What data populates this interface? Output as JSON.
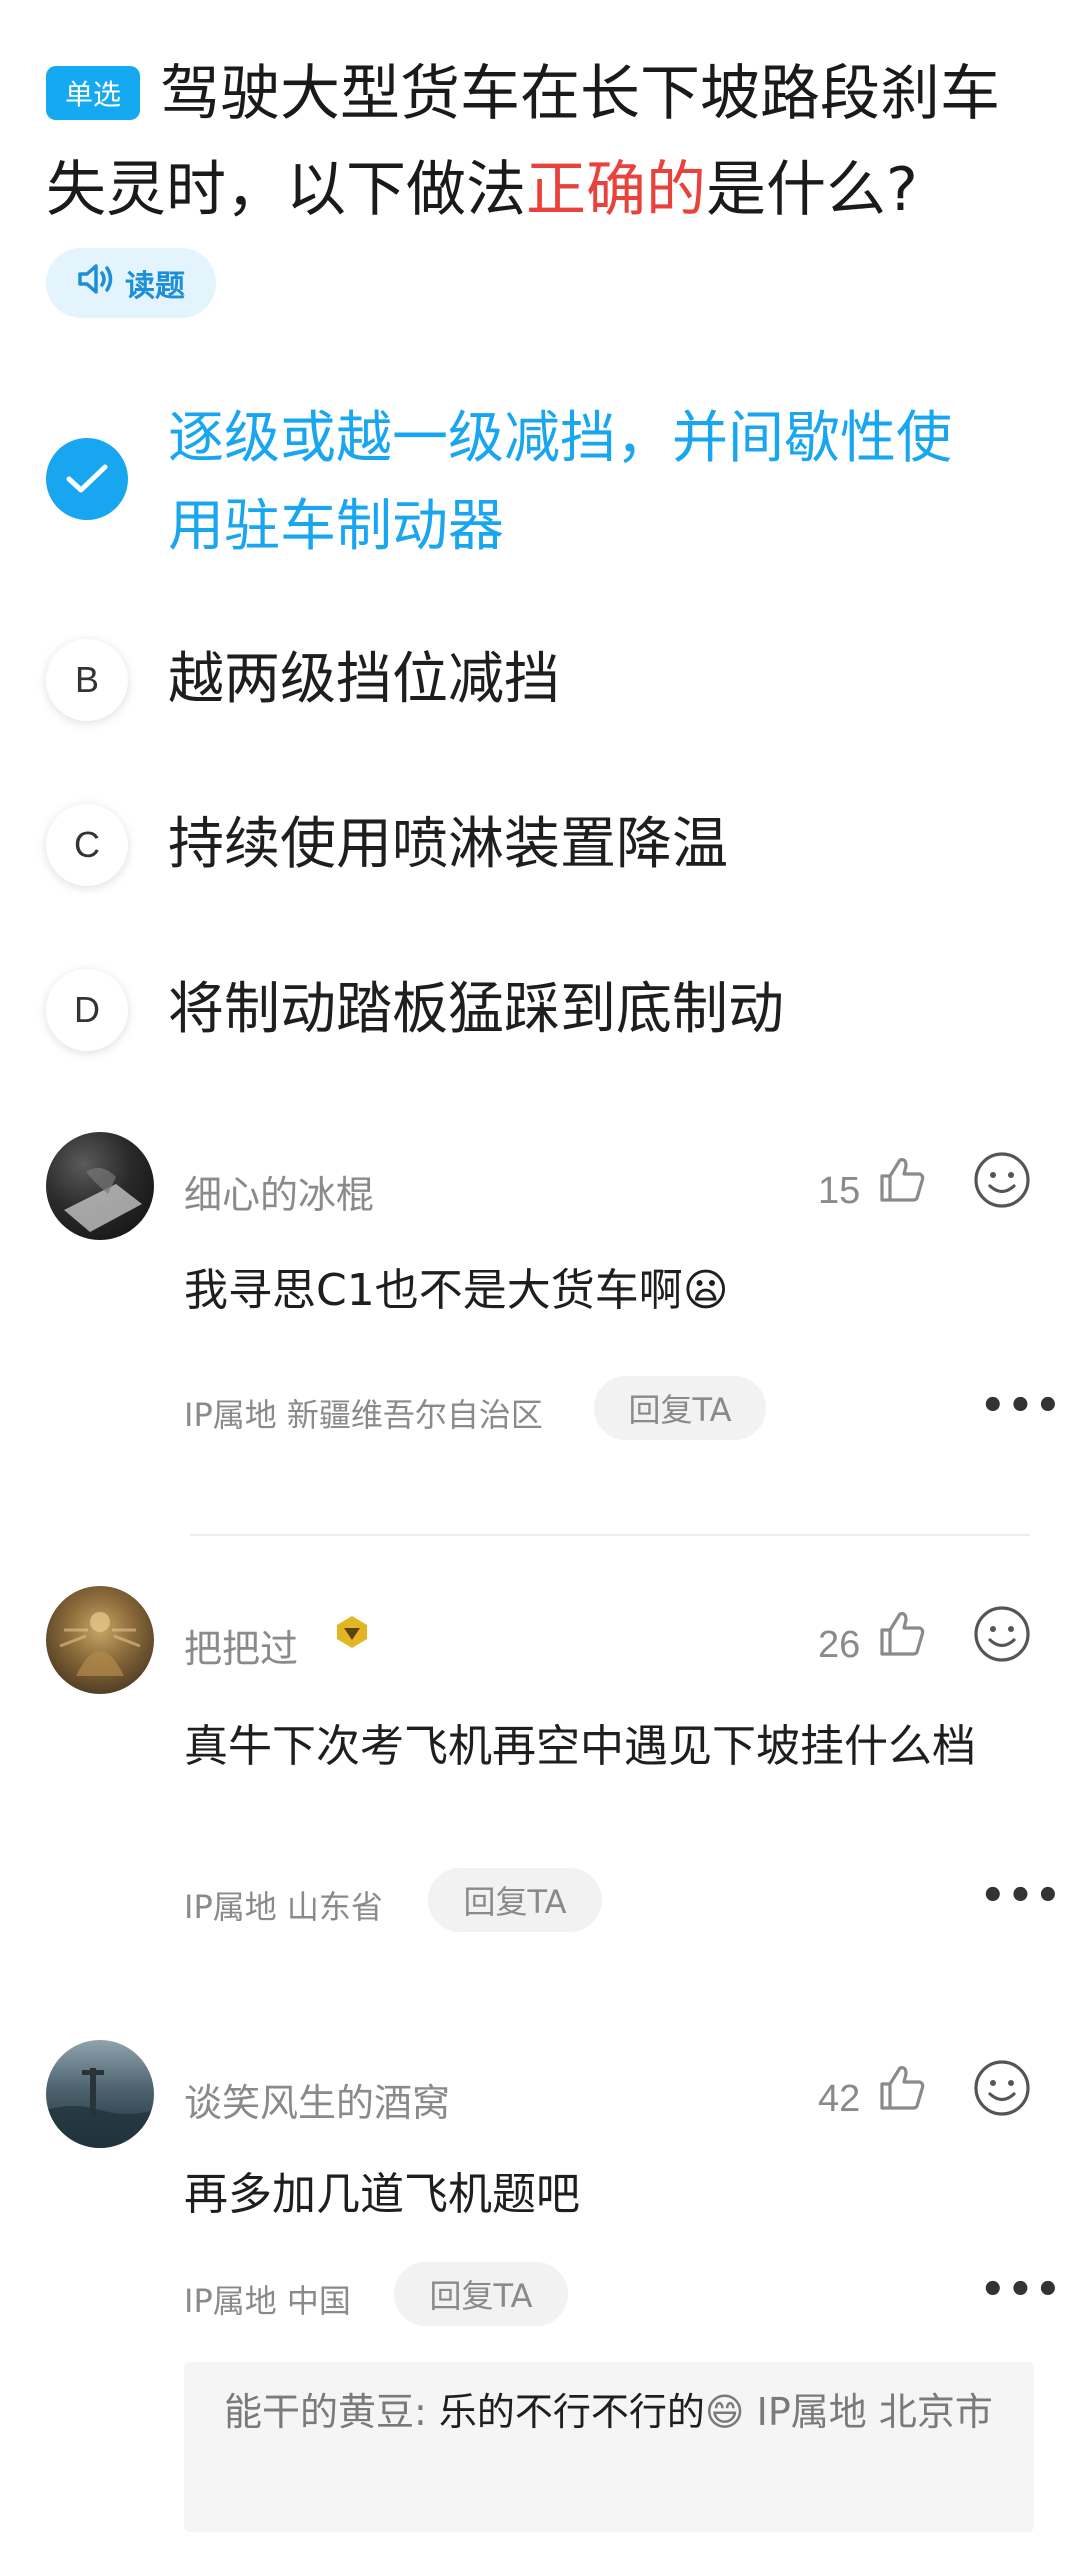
{
  "question": {
    "type_badge": "单选",
    "line1": "驾驶大型货车在长下坡路段刹车",
    "line2_a": "失灵时，以下做法",
    "line2_highlight": "正确的",
    "line2_b": "是什么?",
    "read_label": "读题"
  },
  "options": [
    {
      "letter": "",
      "line1": "逐级或越一级减挡，并间歇性使",
      "line2": "用驻车制动器",
      "selected": true
    },
    {
      "letter": "B",
      "text": "越两级挡位减挡"
    },
    {
      "letter": "C",
      "text": "持续使用喷淋装置降温"
    },
    {
      "letter": "D",
      "text": "将制动踏板猛踩到底制动"
    }
  ],
  "comments": [
    {
      "user": "细心的冰棍",
      "likes": "15",
      "text": "我寻思C1也不是大货车啊",
      "emoji": "😦",
      "ip": "IP属地 新疆维吾尔自治区",
      "reply": "回复TA"
    },
    {
      "user": "把把过",
      "likes": "26",
      "text": "真牛下次考飞机再空中遇见下坡挂什么档",
      "ip": "IP属地 山东省",
      "reply": "回复TA"
    },
    {
      "user": "谈笑风生的酒窝",
      "likes": "42",
      "text": "再多加几道飞机题吧",
      "ip": "IP属地 中国",
      "reply": "回复TA",
      "sub_reply": {
        "user": "能干的黄豆",
        "text": "乐的不行不行的",
        "emoji": "😄",
        "ip": "IP属地 北京市"
      }
    }
  ],
  "icons": {
    "like": "thumbs-up-icon",
    "emoji": "smiley-icon",
    "more": "more-dots-icon",
    "speaker": "speaker-icon",
    "check": "check-icon",
    "badge": "gold-badge-icon"
  },
  "colors": {
    "accent": "#19a6f1",
    "highlight": "#e8423b",
    "muted": "#8a8a8a"
  },
  "more_label": "•••"
}
